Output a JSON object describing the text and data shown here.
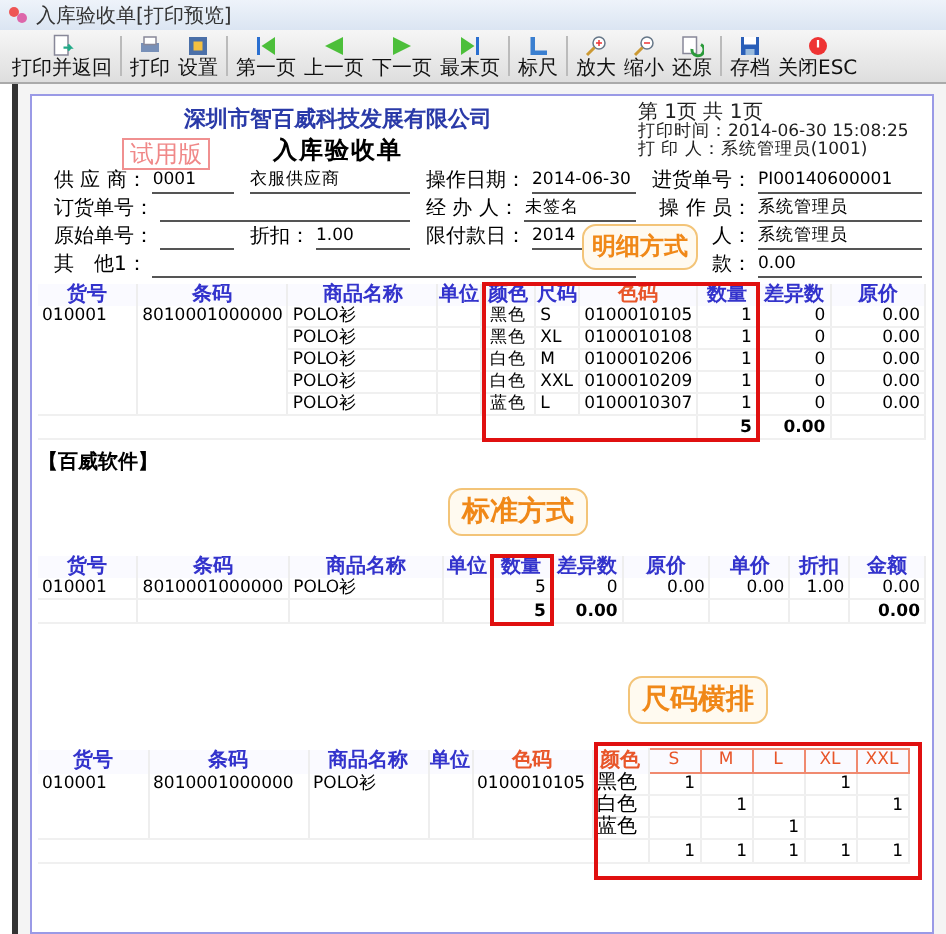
{
  "window": {
    "title": "入库验收单[打印预览]"
  },
  "toolbar": [
    {
      "label": "打印并返回",
      "kind": "print-return"
    },
    {
      "label": "打印",
      "kind": "print"
    },
    {
      "label": "设置",
      "kind": "settings"
    },
    {
      "label": "第一页",
      "kind": "first"
    },
    {
      "label": "上一页",
      "kind": "prev"
    },
    {
      "label": "下一页",
      "kind": "next"
    },
    {
      "label": "最末页",
      "kind": "last"
    },
    {
      "label": "标尺",
      "kind": "ruler"
    },
    {
      "label": "放大",
      "kind": "zoom-in"
    },
    {
      "label": "缩小",
      "kind": "zoom-out"
    },
    {
      "label": "还原",
      "kind": "restore"
    },
    {
      "label": "存档",
      "kind": "save"
    },
    {
      "label": "关闭ESC",
      "kind": "close"
    }
  ],
  "document": {
    "company": "深圳市智百威科技发展有限公司",
    "title": "入库验收单",
    "stamp": "试用版",
    "page_info": [
      "第 1页 共 1页",
      "打印时间：2014-06-30 15:08:25",
      "打 印 人：系统管理员(1001)"
    ],
    "fields": [
      [
        {
          "label": "供 应 商：",
          "value": "0001"
        },
        {
          "value": "衣服供应商"
        },
        {
          "label": "操作日期：",
          "value": "2014-06-30"
        },
        {
          "label": "进货单号：",
          "value": "PI00140600001"
        }
      ],
      [
        {
          "label": "订货单号："
        },
        {
          "label": "经 办 人：",
          "value": "未签名"
        },
        {
          "label": "操 作 员：",
          "value": "系统管理员"
        }
      ],
      [
        {
          "label": "原始单号："
        },
        {
          "label": "折扣：",
          "value": "1.00"
        },
        {
          "label": "限付款日：",
          "value": "2014"
        },
        {
          "label": "人：",
          "value": "系统管理员"
        }
      ],
      [
        {
          "label": "其　他1："
        },
        {
          "label": "款：",
          "value": "0.00"
        }
      ]
    ],
    "footer": "【百威软件】"
  },
  "detail_table": {
    "callout": "明细方式",
    "columns": [
      {
        "label": "货号",
        "color": "#3333cc"
      },
      {
        "label": "条码",
        "color": "#3333cc"
      },
      {
        "label": "商品名称",
        "color": "#3333cc"
      },
      {
        "label": "单位",
        "color": "#3333cc"
      },
      {
        "label": "颜色",
        "color": "#3333cc"
      },
      {
        "label": "尺码",
        "color": "#3333cc"
      },
      {
        "label": "色码",
        "color": "#e8562a"
      },
      {
        "label": "数量",
        "color": "#3333cc"
      },
      {
        "label": "差异数",
        "color": "#3333cc"
      },
      {
        "label": "原价",
        "color": "#3333cc"
      }
    ],
    "code": "010001",
    "barcode": "8010001000000",
    "rows": [
      {
        "name": "POLO衫",
        "color_name": "黑色",
        "size": "S",
        "color_code": "0100010105",
        "qty": "1",
        "diff": "0",
        "price": "0.00"
      },
      {
        "name": "POLO衫",
        "color_name": "黑色",
        "size": "XL",
        "color_code": "0100010108",
        "qty": "1",
        "diff": "0",
        "price": "0.00"
      },
      {
        "name": "POLO衫",
        "color_name": "白色",
        "size": "M",
        "color_code": "0100010206",
        "qty": "1",
        "diff": "0",
        "price": "0.00"
      },
      {
        "name": "POLO衫",
        "color_name": "白色",
        "size": "XXL",
        "color_code": "0100010209",
        "qty": "1",
        "diff": "0",
        "price": "0.00"
      },
      {
        "name": "POLO衫",
        "color_name": "蓝色",
        "size": "L",
        "color_code": "0100010307",
        "qty": "1",
        "diff": "0",
        "price": "0.00"
      }
    ],
    "total_qty": "5",
    "total_diff": "0.00"
  },
  "standard_table": {
    "callout": "标准方式",
    "columns": [
      {
        "label": "货号",
        "color": "#3333cc"
      },
      {
        "label": "条码",
        "color": "#3333cc"
      },
      {
        "label": "商品名称",
        "color": "#3333cc"
      },
      {
        "label": "单位",
        "color": "#3333cc"
      },
      {
        "label": "数量",
        "color": "#3333cc"
      },
      {
        "label": "差异数",
        "color": "#3333cc"
      },
      {
        "label": "原价",
        "color": "#3333cc"
      },
      {
        "label": "单价",
        "color": "#3333cc"
      },
      {
        "label": "折扣",
        "color": "#3333cc"
      },
      {
        "label": "金额",
        "color": "#3333cc"
      }
    ],
    "row": {
      "code": "010001",
      "barcode": "8010001000000",
      "name": "POLO衫",
      "qty": "5",
      "diff": "0",
      "price": "0.00",
      "unit_price": "0.00",
      "discount": "1.00",
      "amount": "0.00"
    },
    "total": {
      "qty": "5",
      "diff": "0.00",
      "amount": "0.00"
    }
  },
  "size_table": {
    "callout": "尺码横排",
    "columns": [
      {
        "label": "货号",
        "color": "#3333cc"
      },
      {
        "label": "条码",
        "color": "#3333cc"
      },
      {
        "label": "商品名称",
        "color": "#3333cc"
      },
      {
        "label": "单位",
        "color": "#3333cc"
      },
      {
        "label": "色码",
        "color": "#e8562a"
      },
      {
        "label": "颜色",
        "color": "#e8562a"
      }
    ],
    "sizes": [
      "S",
      "M",
      "L",
      "XL",
      "XXL"
    ],
    "code": "010001",
    "barcode": "8010001000000",
    "name": "POLO衫",
    "color_code": "0100010105",
    "rows": [
      {
        "color_name": "黑色",
        "cells": [
          {
            "kind": "count",
            "value": "1"
          },
          {
            "kind": "blank"
          },
          {
            "kind": "blank"
          },
          {
            "kind": "count",
            "value": "1"
          },
          {
            "kind": "blank"
          }
        ]
      },
      {
        "color_name": "白色",
        "cells": [
          {
            "kind": "blank"
          },
          {
            "kind": "count",
            "value": "1"
          },
          {
            "kind": "blank"
          },
          {
            "kind": "blank"
          },
          {
            "kind": "count",
            "value": "1"
          }
        ]
      },
      {
        "color_name": "蓝色",
        "cells": [
          {
            "kind": "blank"
          },
          {
            "kind": "blank"
          },
          {
            "kind": "count",
            "value": "1"
          },
          {
            "kind": "blank"
          },
          {
            "kind": "blank"
          }
        ]
      }
    ],
    "totals": [
      "1",
      "1",
      "1",
      "1",
      "1"
    ]
  }
}
